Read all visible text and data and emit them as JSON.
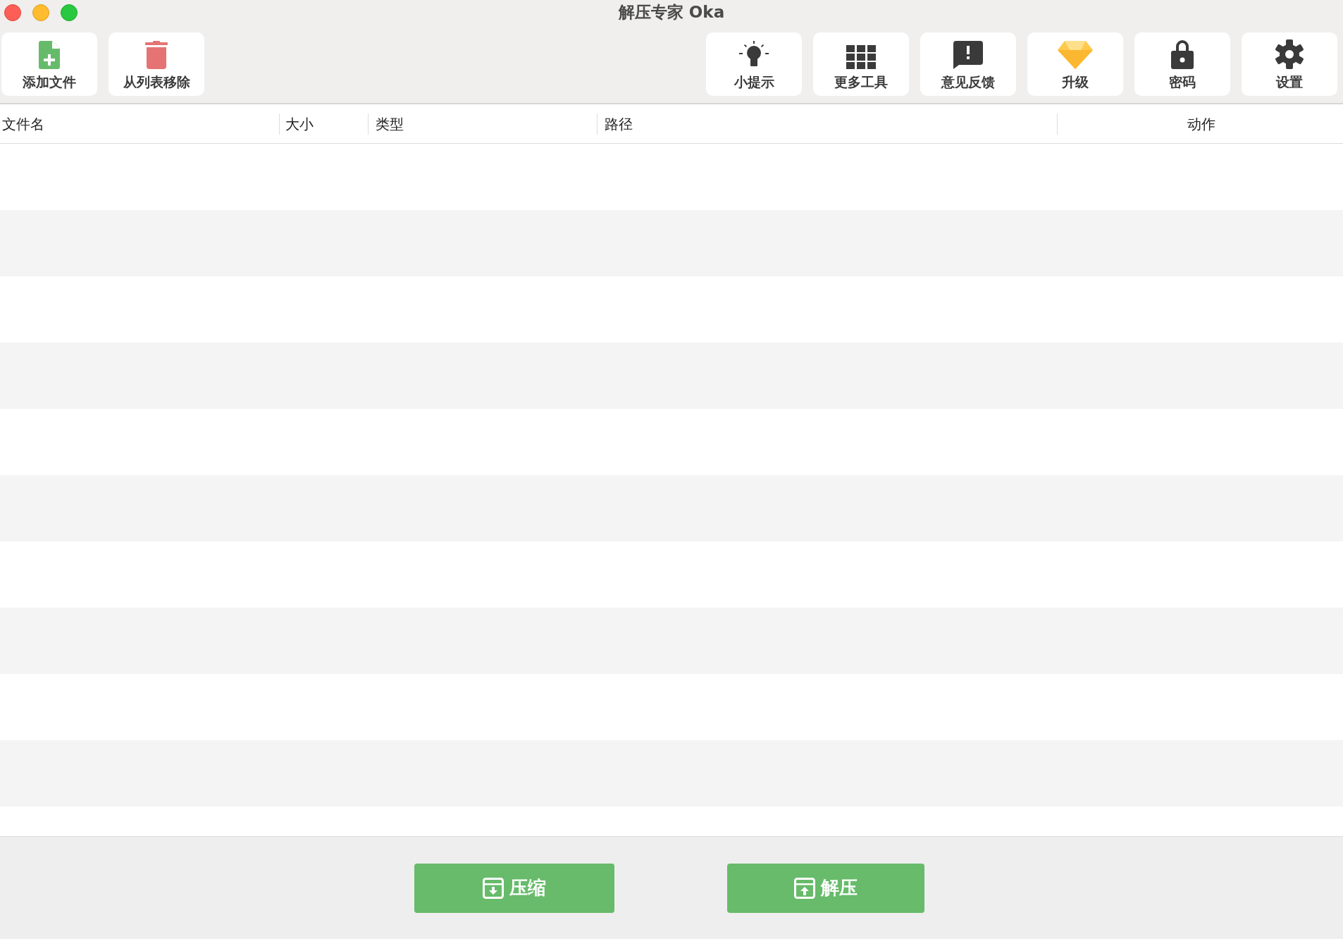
{
  "window": {
    "title": "解压专家 Oka"
  },
  "toolbar": {
    "left": [
      {
        "label": "添加文件"
      },
      {
        "label": "从列表移除"
      }
    ],
    "right": [
      {
        "label": "小提示"
      },
      {
        "label": "更多工具"
      },
      {
        "label": "意见反馈"
      },
      {
        "label": "升级"
      },
      {
        "label": "密码"
      },
      {
        "label": "设置"
      }
    ]
  },
  "table": {
    "columns": [
      {
        "label": "文件名"
      },
      {
        "label": "大小"
      },
      {
        "label": "类型"
      },
      {
        "label": "路径"
      },
      {
        "label": "动作"
      }
    ]
  },
  "actions": [
    {
      "label": "压缩"
    },
    {
      "label": "解压"
    }
  ]
}
